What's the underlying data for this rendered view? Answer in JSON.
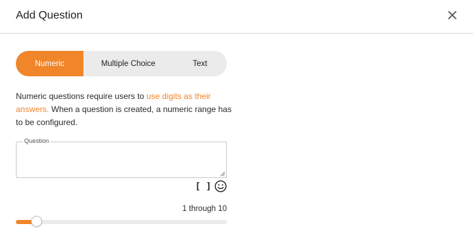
{
  "dialog": {
    "title": "Add Question",
    "close_icon": "close-icon"
  },
  "tabs": [
    {
      "label": "Numeric",
      "active": true
    },
    {
      "label": "Multiple Choice",
      "active": false
    },
    {
      "label": "Text",
      "active": false
    }
  ],
  "description": {
    "part1": "Numeric questions require users to ",
    "highlight": "use digits as their answers.",
    "part2": " When a question is created, a numeric range has to be configured."
  },
  "question_field": {
    "label": "Question",
    "value": ""
  },
  "tools": {
    "bracket_icon": "[ ]",
    "emoji_icon": "smiley-icon"
  },
  "range": {
    "label": "1 through 10",
    "min": 1,
    "max": 10,
    "slider_fraction": 0.09
  },
  "colors": {
    "accent": "#f0852a",
    "segment_bg": "#ebebeb",
    "track_bg": "#ececec"
  }
}
